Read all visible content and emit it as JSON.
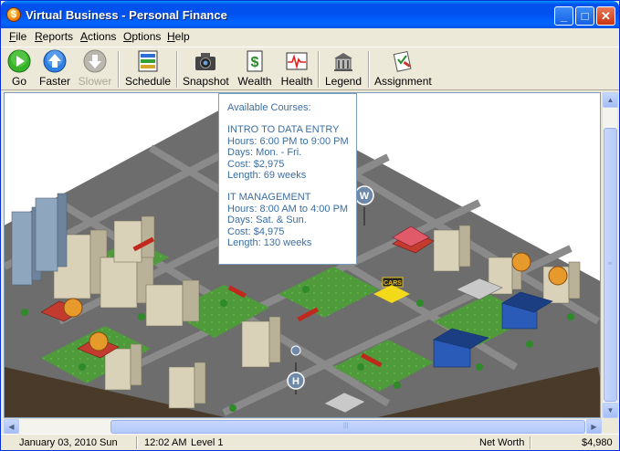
{
  "window": {
    "title": "Virtual Business - Personal Finance",
    "app_icon_letter": "$",
    "controls": {
      "minimize": "_",
      "maximize": "□",
      "close": "✕"
    }
  },
  "menu": {
    "items": [
      "File",
      "Reports",
      "Actions",
      "Options",
      "Help"
    ]
  },
  "toolbar": {
    "go": "Go",
    "faster": "Faster",
    "slower": "Slower",
    "schedule": "Schedule",
    "snapshot": "Snapshot",
    "wealth": "Wealth",
    "health": "Health",
    "legend": "Legend",
    "assignment": "Assignment"
  },
  "tooltip": {
    "heading": "Available Courses:",
    "courses": [
      {
        "name": "INTRO TO DATA ENTRY",
        "hours": "Hours: 6:00 PM to 9:00 PM",
        "days": "Days: Mon. - Fri.",
        "cost": "Cost: $2,975",
        "length": "Length: 69 weeks"
      },
      {
        "name": "IT MANAGEMENT",
        "hours": "Hours: 8:00 AM to 4:00 PM",
        "days": "Days: Sat. & Sun.",
        "cost": "Cost: $4,975",
        "length": "Length: 130 weeks"
      }
    ]
  },
  "map": {
    "sign_cars": "CARS",
    "marker_w": "W",
    "marker_h": "H"
  },
  "status": {
    "date": "January 03, 2010",
    "day": "Sun",
    "time": "12:02 AM",
    "level": "Level 1",
    "net_worth_label": "Net Worth",
    "net_worth_value": "$4,980"
  },
  "colors": {
    "title_bar": "#0055e5",
    "tooltip_text": "#3a6ea5",
    "grass": "#3d8f2e",
    "road": "#6e6e6e",
    "ground_edge": "#4a3a2a"
  }
}
